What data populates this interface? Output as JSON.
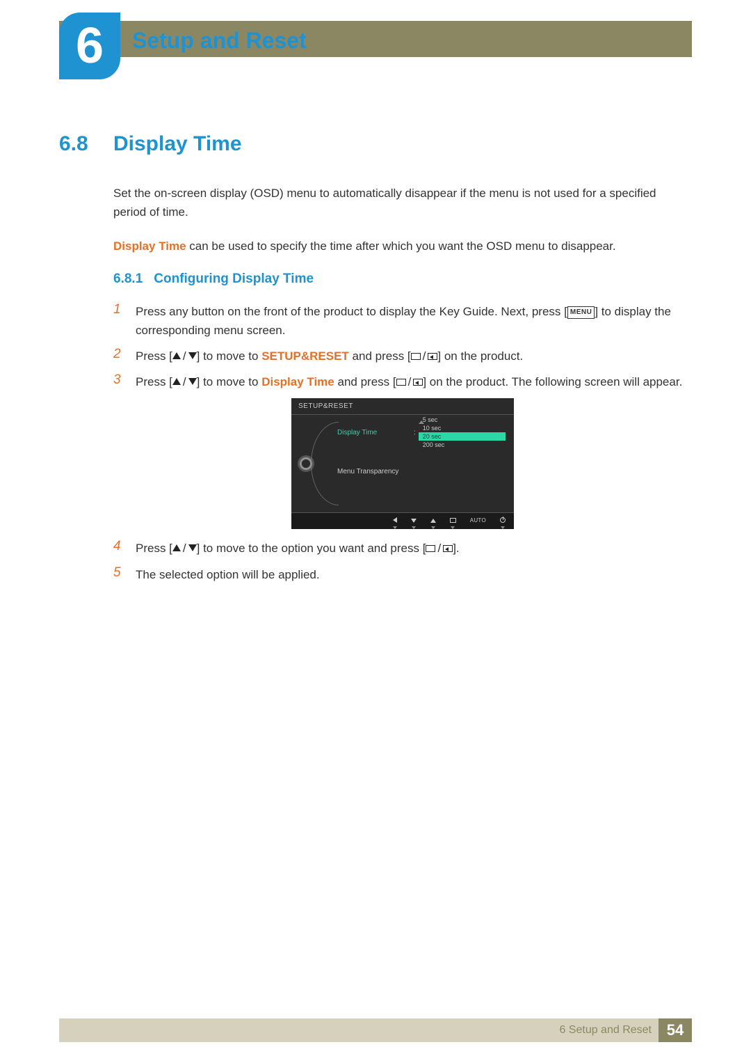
{
  "chapter": {
    "number": "6",
    "title": "Setup and Reset"
  },
  "section": {
    "number": "6.8",
    "title": "Display Time"
  },
  "intro1": "Set the on-screen display (OSD) menu to automatically disappear if the menu is not used for a specified period of time.",
  "intro2_term": "Display Time",
  "intro2_rest": " can be used to specify the time after which you want the OSD menu to disappear.",
  "subsection": {
    "number": "6.8.1",
    "title": "Configuring Display Time"
  },
  "steps": {
    "s1_a": "Press any button on the front of the product to display the Key Guide. Next, press [",
    "s1_menu": "MENU",
    "s1_b": "] to display the corresponding menu screen.",
    "s2_a": "Press [",
    "s2_b": "] to move to ",
    "s2_term": "SETUP&RESET",
    "s2_c": " and press [",
    "s2_d": "] on the product.",
    "s3_a": "Press [",
    "s3_b": "] to move to ",
    "s3_term": "Display Time",
    "s3_c": " and press [",
    "s3_d": "] on the product. The following screen will appear.",
    "s4_a": "Press [",
    "s4_b": "] to move to the option you want and press [",
    "s4_c": "].",
    "s5": "The selected option will be applied."
  },
  "nums": {
    "n1": "1",
    "n2": "2",
    "n3": "3",
    "n4": "4",
    "n5": "5"
  },
  "osd": {
    "title": "SETUP&RESET",
    "items": [
      {
        "label": "Display Time",
        "active": true
      },
      {
        "label": "Menu Transparency",
        "active": false
      }
    ],
    "options": [
      "5 sec",
      "10 sec",
      "20 sec",
      "200 sec"
    ],
    "selected_index": 2,
    "bottom_auto": "AUTO"
  },
  "footer": {
    "chapter_ref": "6 Setup and Reset",
    "page": "54"
  }
}
